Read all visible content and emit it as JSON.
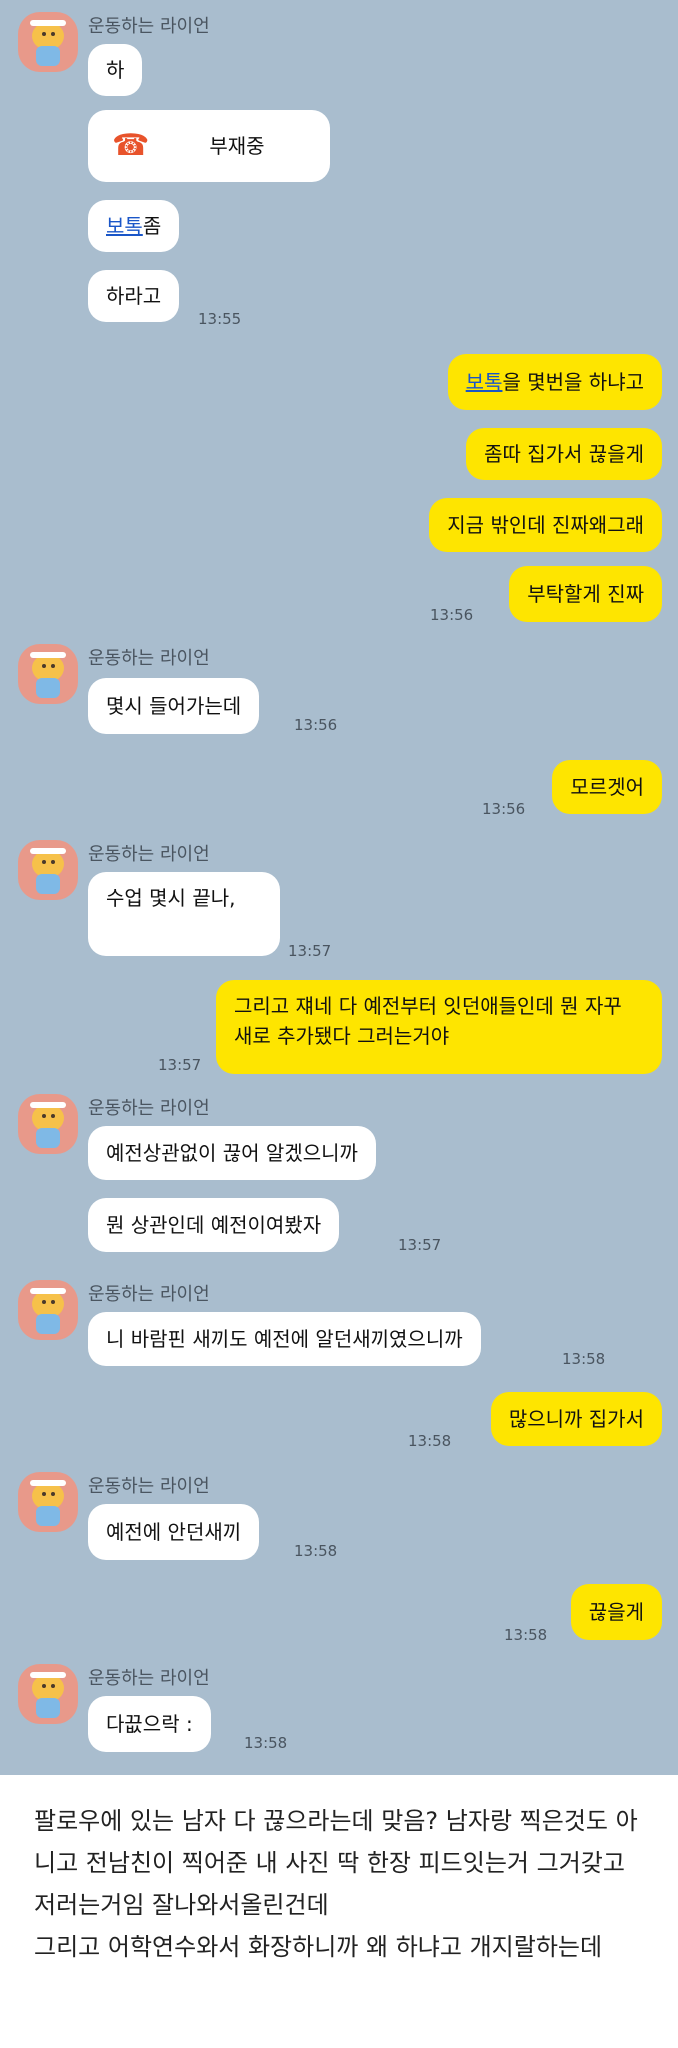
{
  "chat": {
    "sender": "운동하는 라이언",
    "msgs": {
      "m1": "하",
      "call_label": "부재중",
      "m3_link": "보톡",
      "m3_rest": "좀",
      "m4": "하라고",
      "t1": "13:55",
      "o1_link": "보톡",
      "o1_rest": "을 몇번을 하냐고",
      "o2": "좀따 집가서 끊을게",
      "o3": "지금 밖인데 진짜왜그래",
      "o4": "부탁할게 진짜",
      "t2": "13:56",
      "m5": "몇시 들어가는데",
      "t3": "13:56",
      "o5": "모르겟어",
      "t4": "13:56",
      "m6": "수업 몇시 끝나,",
      "t5": "13:57",
      "o6": "그리고 쟤네 다 예전부터 잇던애들인데 뭔 자꾸 새로 추가됐다 그러는거야",
      "t6": "13:57",
      "m7": "예전상관없이 끊어 알겠으니까",
      "m8": "뭔 상관인데 예전이여봤자",
      "t7": "13:57",
      "m9": "니 바람핀 새끼도 예전에 알던새끼였으니까",
      "t8": "13:58",
      "o7": "많으니까 집가서",
      "t9": "13:58",
      "m10": "예전에 안던새끼",
      "t10": "13:58",
      "o8": "끊을게",
      "t11": "13:58",
      "m11": "다끖으락 :",
      "t12": "13:58"
    }
  },
  "caption": {
    "text": "팔로우에 있는 남자 다 끊으라는데 맞음? 남자랑 찍은것도 아니고 전남친이 찍어준 내 사진 딱 한장 피드잇는거 그거갖고 저러는거임 잘나와서올린건데\n그리고 어학연수와서 화장하니까 왜 하냐고 개지랄하는데"
  },
  "colors": {
    "chat_bg": "#a9bdce",
    "my_bubble": "#fee500",
    "their_bubble": "#ffffff",
    "link": "#1a56c8"
  },
  "icons": {
    "avatar": "ryan-avatar-icon",
    "missed_call": "missed-call-icon"
  }
}
